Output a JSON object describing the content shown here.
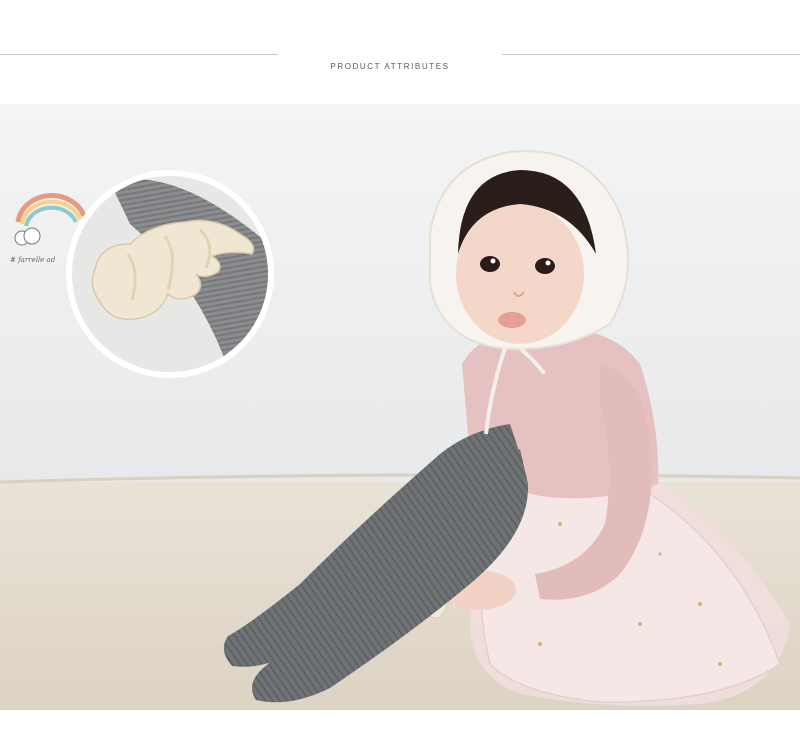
{
  "header": {
    "title": "PRODUCT ATTRIBUTES"
  },
  "photo": {
    "subject": "toddler-wearing-grey-ribbed-tights-with-angel-wing-appliqué",
    "inset_zoom": "angel-wing-detail",
    "sticker_text": "# farrelle ad",
    "colors": {
      "wall": "#eef0f2",
      "rug": "#e6ddd0",
      "tights": "#6f7275",
      "dress": "#e7c6c4",
      "wing": "#f2ead8"
    }
  }
}
